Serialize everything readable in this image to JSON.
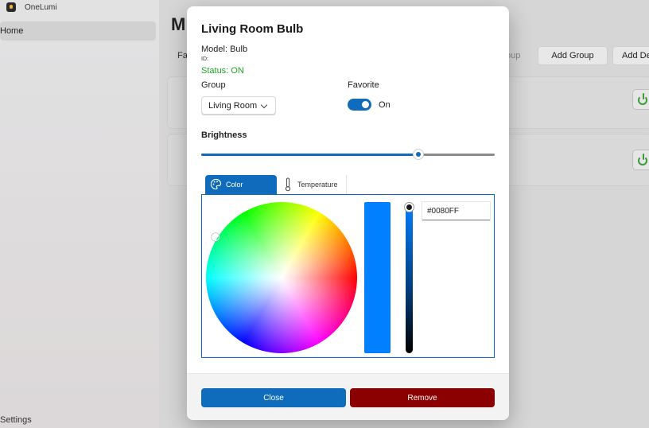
{
  "app": {
    "title": "OneLumi",
    "nav_home": "Home",
    "nav_settings": "Settings"
  },
  "main": {
    "page_title": "M",
    "favorites_label": "Fa",
    "add_group_partial": "oup",
    "add_group": "Add Group",
    "add_device": "Add De"
  },
  "dialog": {
    "title": "Living Room Bulb",
    "model": "Model: Bulb",
    "id": "ID:",
    "status": "Status: ON",
    "group_label": "Group",
    "group_value": "Living Room",
    "favorite_label": "Favorite",
    "favorite_state": "On",
    "brightness_label": "Brightness",
    "brightness_value": 0.74,
    "tabs": {
      "color": "Color",
      "temperature": "Temperature"
    },
    "hex_value": "#0080FF",
    "selected_color": "#0080ff",
    "close_label": "Close",
    "remove_label": "Remove"
  },
  "colors": {
    "accent": "#0f6cbd",
    "status_on": "#22a32a",
    "danger": "#8b0000"
  },
  "icons": {
    "app": "onelumi-logo-icon",
    "power": "power-icon",
    "palette": "palette-icon",
    "thermometer": "thermometer-icon",
    "chevron": "chevron-down-icon"
  }
}
